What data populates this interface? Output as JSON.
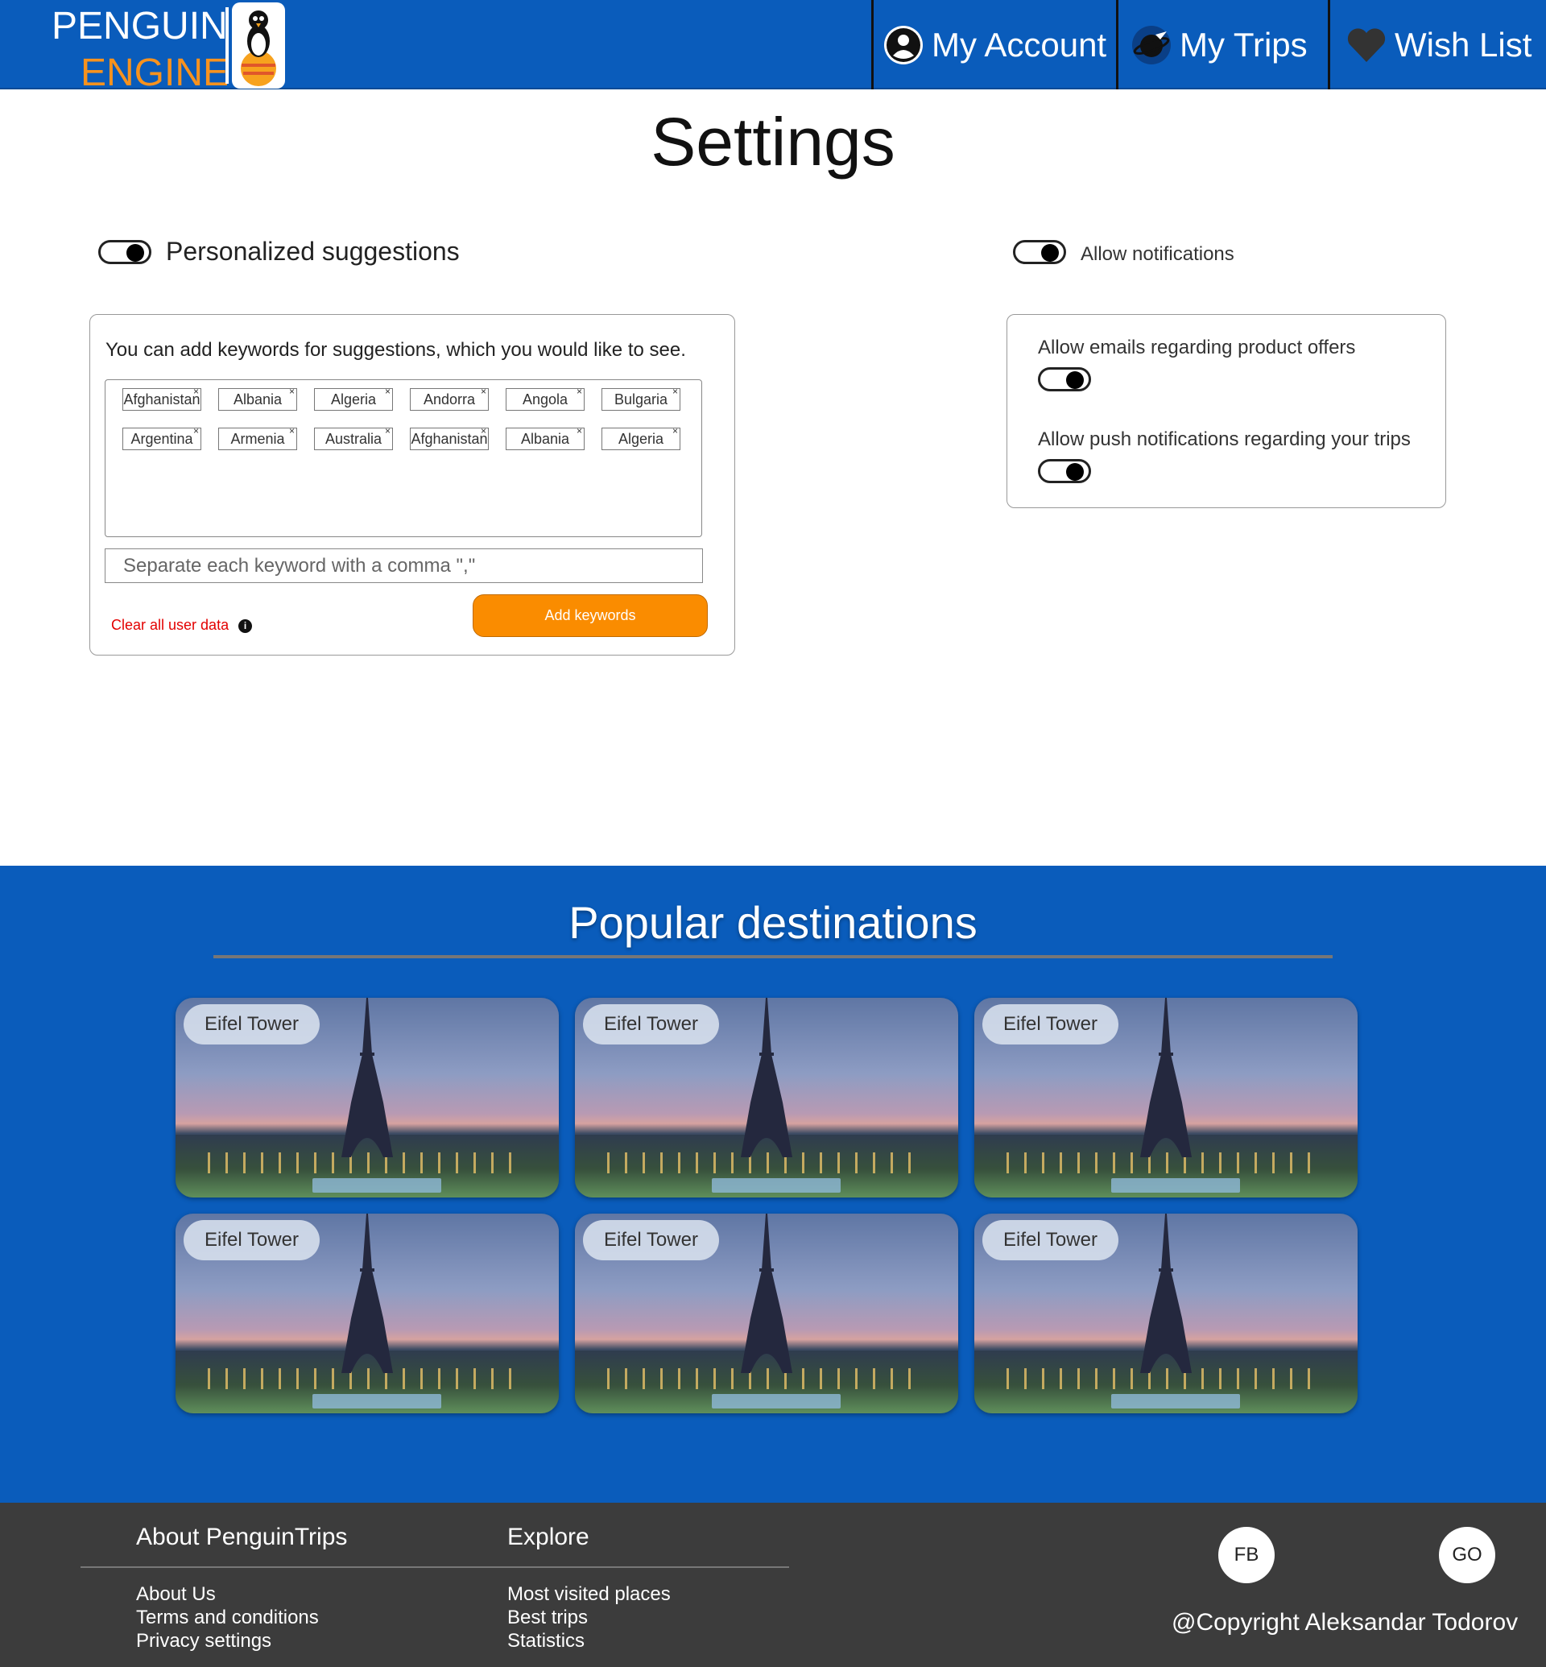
{
  "brand": {
    "line1": "PENGUIN",
    "line2": "ENGINE"
  },
  "nav": {
    "account": {
      "label": "My Account",
      "icon": "user-circle-icon"
    },
    "trips": {
      "label": "My Trips",
      "icon": "planet-plane-icon"
    },
    "wishlist": {
      "label": "Wish List",
      "icon": "heart-icon"
    }
  },
  "settings": {
    "title": "Settings",
    "personalized": {
      "label": "Personalized suggestions",
      "enabled": true
    },
    "notifications": {
      "label": "Allow notifications",
      "enabled": true
    },
    "keywords": {
      "intro": "You can add keywords for suggestions, which you would like to see.",
      "chips_row1": [
        "Afghanistan",
        "Albania",
        "Algeria",
        "Andorra",
        "Angola",
        "Bulgaria"
      ],
      "chips_row2": [
        "Argentina",
        "Armenia",
        "Australia",
        "Afghanistan",
        "Albania",
        "Algeria"
      ],
      "remove_glyph": "×",
      "input_placeholder": "Separate each keyword with a comma \",\"",
      "add_button": "Add keywords",
      "clear_link": "Clear all user data",
      "info_glyph": "i"
    },
    "notif_options": {
      "emails": {
        "label": "Allow emails regarding product offers",
        "enabled": true
      },
      "push": {
        "label": "Allow push notifications regarding your trips",
        "enabled": true
      }
    }
  },
  "popular": {
    "title": "Popular destinations",
    "cards": [
      "Eifel Tower",
      "Eifel Tower",
      "Eifel Tower",
      "Eifel Tower",
      "Eifel Tower",
      "Eifel Tower"
    ]
  },
  "footer": {
    "about_heading": "About PenguinTrips",
    "about_links": [
      "About Us",
      "Terms and conditions",
      "Privacy settings"
    ],
    "explore_heading": "Explore",
    "explore_links": [
      "Most visited places",
      "Best trips",
      "Statistics"
    ],
    "social": {
      "fb": "FB",
      "go": "GO"
    },
    "copyright": "@Copyright Aleksandar Todorov"
  },
  "colors": {
    "brand_blue": "#0a5cbb",
    "accent_orange": "#fa8c00",
    "footer_bg": "#3c3c3c",
    "danger_red": "#e30000"
  }
}
